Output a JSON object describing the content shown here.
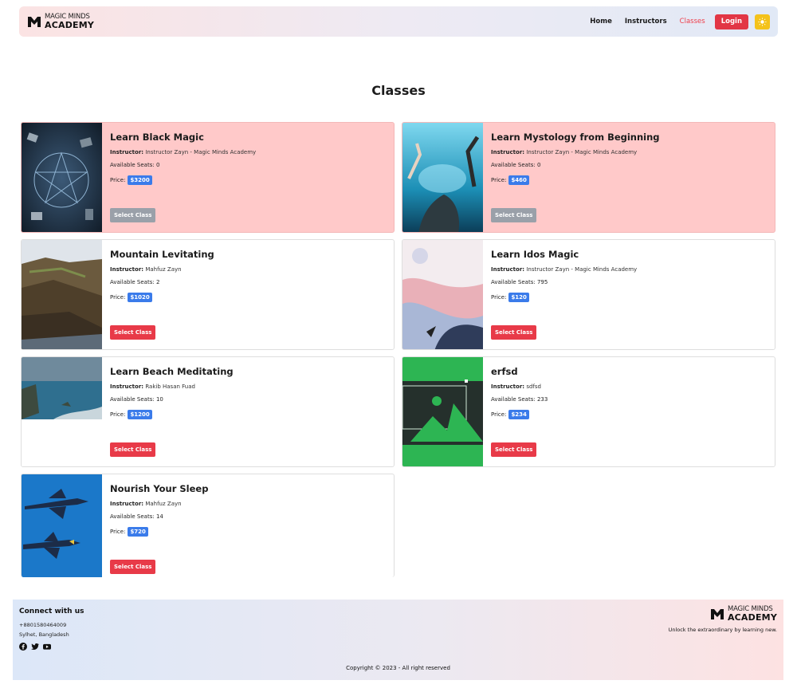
{
  "nav": {
    "brand_top": "MAGIC MINDS",
    "brand_bottom": "ACADEMY",
    "links": [
      "Home",
      "Instructors",
      "Classes"
    ],
    "login_label": "Login",
    "theme_icon": "sun-icon"
  },
  "page_title": "Classes",
  "labels": {
    "instructor": "Instructor:",
    "seats": "Available Seats:",
    "price": "Price:",
    "select": "Select Class"
  },
  "classes": [
    {
      "title": "Learn Black Magic",
      "instructor": "Instructor Zayn - Magic Minds Academy",
      "seats": "0",
      "price": "$3200",
      "full": true
    },
    {
      "title": "Learn Mystology from Beginning",
      "instructor": "Instructor Zayn - Magic Minds Academy",
      "seats": "0",
      "price": "$460",
      "full": true
    },
    {
      "title": "Mountain Levitating",
      "instructor": "Mahfuz Zayn",
      "seats": "2",
      "price": "$1020",
      "full": false
    },
    {
      "title": "Learn Idos Magic",
      "instructor": "Instructor Zayn - Magic Minds Academy",
      "seats": "795",
      "price": "$120",
      "full": false
    },
    {
      "title": "Learn Beach Meditating",
      "instructor": "Rakib Hasan Fuad",
      "seats": "10",
      "price": "$1200",
      "full": false
    },
    {
      "title": "erfsd",
      "instructor": "sdfsd",
      "seats": "233",
      "price": "$234",
      "full": false
    },
    {
      "title": "Nourish Your Sleep",
      "instructor": "Mahfuz Zayn",
      "seats": "14",
      "price": "$720",
      "full": false
    }
  ],
  "footer": {
    "connect": "Connect with us",
    "phone": "+8801580464009",
    "location": "Sylhet, Bangladesh",
    "social_icons": [
      "facebook-icon",
      "twitter-icon",
      "youtube-icon"
    ],
    "brand_top": "MAGIC MINDS",
    "brand_bottom": "ACADEMY",
    "tagline": "Unlock the extraordinary by learning new.",
    "copyright": "Copyright © 2023 - All right reserved"
  },
  "colors": {
    "accent_red": "#e23645",
    "price_blue": "#3a7bea",
    "full_card": "#ffc9c9",
    "theme_yellow": "#f4c21a"
  }
}
